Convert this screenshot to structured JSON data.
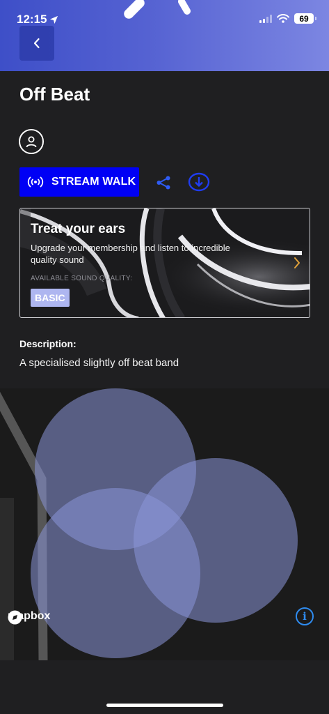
{
  "status_bar": {
    "time": "12:15",
    "battery": "69"
  },
  "header": {
    "title": "Off Beat",
    "back_icon": "chevron-left-icon"
  },
  "actions": {
    "stream_label": "STREAM WALK",
    "stream_icon": "broadcast-icon",
    "share_icon": "share-icon",
    "download_icon": "download-icon",
    "accent_color": "#0000f5",
    "icon_color": "#2f5cf5"
  },
  "promo": {
    "title": "Treat your ears",
    "subtitle": "Upgrade your membership and listen to incredible quality sound",
    "quality_label": "AVAILABLE SOUND QUALITY:",
    "quality_value": "BASIC",
    "arrow_color": "#e2a23a"
  },
  "description": {
    "heading": "Description:",
    "text": "A specialised slightly off beat band"
  },
  "map": {
    "attribution": "mapbox",
    "info_icon": "info-icon",
    "zone_color": "#8b95d8"
  }
}
